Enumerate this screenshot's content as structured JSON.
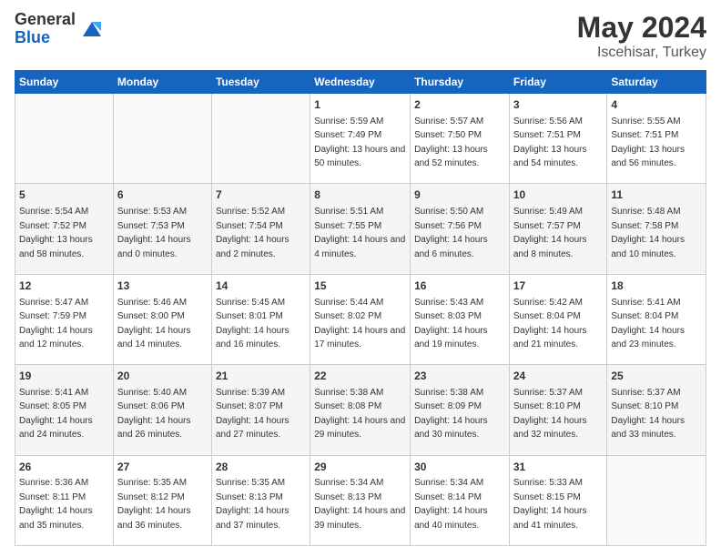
{
  "header": {
    "logo_general": "General",
    "logo_blue": "Blue",
    "month": "May 2024",
    "location": "Iscehisar, Turkey"
  },
  "weekdays": [
    "Sunday",
    "Monday",
    "Tuesday",
    "Wednesday",
    "Thursday",
    "Friday",
    "Saturday"
  ],
  "weeks": [
    [
      {
        "day": "",
        "sunrise": "",
        "sunset": "",
        "daylight": ""
      },
      {
        "day": "",
        "sunrise": "",
        "sunset": "",
        "daylight": ""
      },
      {
        "day": "",
        "sunrise": "",
        "sunset": "",
        "daylight": ""
      },
      {
        "day": "1",
        "sunrise": "Sunrise: 5:59 AM",
        "sunset": "Sunset: 7:49 PM",
        "daylight": "Daylight: 13 hours and 50 minutes."
      },
      {
        "day": "2",
        "sunrise": "Sunrise: 5:57 AM",
        "sunset": "Sunset: 7:50 PM",
        "daylight": "Daylight: 13 hours and 52 minutes."
      },
      {
        "day": "3",
        "sunrise": "Sunrise: 5:56 AM",
        "sunset": "Sunset: 7:51 PM",
        "daylight": "Daylight: 13 hours and 54 minutes."
      },
      {
        "day": "4",
        "sunrise": "Sunrise: 5:55 AM",
        "sunset": "Sunset: 7:51 PM",
        "daylight": "Daylight: 13 hours and 56 minutes."
      }
    ],
    [
      {
        "day": "5",
        "sunrise": "Sunrise: 5:54 AM",
        "sunset": "Sunset: 7:52 PM",
        "daylight": "Daylight: 13 hours and 58 minutes."
      },
      {
        "day": "6",
        "sunrise": "Sunrise: 5:53 AM",
        "sunset": "Sunset: 7:53 PM",
        "daylight": "Daylight: 14 hours and 0 minutes."
      },
      {
        "day": "7",
        "sunrise": "Sunrise: 5:52 AM",
        "sunset": "Sunset: 7:54 PM",
        "daylight": "Daylight: 14 hours and 2 minutes."
      },
      {
        "day": "8",
        "sunrise": "Sunrise: 5:51 AM",
        "sunset": "Sunset: 7:55 PM",
        "daylight": "Daylight: 14 hours and 4 minutes."
      },
      {
        "day": "9",
        "sunrise": "Sunrise: 5:50 AM",
        "sunset": "Sunset: 7:56 PM",
        "daylight": "Daylight: 14 hours and 6 minutes."
      },
      {
        "day": "10",
        "sunrise": "Sunrise: 5:49 AM",
        "sunset": "Sunset: 7:57 PM",
        "daylight": "Daylight: 14 hours and 8 minutes."
      },
      {
        "day": "11",
        "sunrise": "Sunrise: 5:48 AM",
        "sunset": "Sunset: 7:58 PM",
        "daylight": "Daylight: 14 hours and 10 minutes."
      }
    ],
    [
      {
        "day": "12",
        "sunrise": "Sunrise: 5:47 AM",
        "sunset": "Sunset: 7:59 PM",
        "daylight": "Daylight: 14 hours and 12 minutes."
      },
      {
        "day": "13",
        "sunrise": "Sunrise: 5:46 AM",
        "sunset": "Sunset: 8:00 PM",
        "daylight": "Daylight: 14 hours and 14 minutes."
      },
      {
        "day": "14",
        "sunrise": "Sunrise: 5:45 AM",
        "sunset": "Sunset: 8:01 PM",
        "daylight": "Daylight: 14 hours and 16 minutes."
      },
      {
        "day": "15",
        "sunrise": "Sunrise: 5:44 AM",
        "sunset": "Sunset: 8:02 PM",
        "daylight": "Daylight: 14 hours and 17 minutes."
      },
      {
        "day": "16",
        "sunrise": "Sunrise: 5:43 AM",
        "sunset": "Sunset: 8:03 PM",
        "daylight": "Daylight: 14 hours and 19 minutes."
      },
      {
        "day": "17",
        "sunrise": "Sunrise: 5:42 AM",
        "sunset": "Sunset: 8:04 PM",
        "daylight": "Daylight: 14 hours and 21 minutes."
      },
      {
        "day": "18",
        "sunrise": "Sunrise: 5:41 AM",
        "sunset": "Sunset: 8:04 PM",
        "daylight": "Daylight: 14 hours and 23 minutes."
      }
    ],
    [
      {
        "day": "19",
        "sunrise": "Sunrise: 5:41 AM",
        "sunset": "Sunset: 8:05 PM",
        "daylight": "Daylight: 14 hours and 24 minutes."
      },
      {
        "day": "20",
        "sunrise": "Sunrise: 5:40 AM",
        "sunset": "Sunset: 8:06 PM",
        "daylight": "Daylight: 14 hours and 26 minutes."
      },
      {
        "day": "21",
        "sunrise": "Sunrise: 5:39 AM",
        "sunset": "Sunset: 8:07 PM",
        "daylight": "Daylight: 14 hours and 27 minutes."
      },
      {
        "day": "22",
        "sunrise": "Sunrise: 5:38 AM",
        "sunset": "Sunset: 8:08 PM",
        "daylight": "Daylight: 14 hours and 29 minutes."
      },
      {
        "day": "23",
        "sunrise": "Sunrise: 5:38 AM",
        "sunset": "Sunset: 8:09 PM",
        "daylight": "Daylight: 14 hours and 30 minutes."
      },
      {
        "day": "24",
        "sunrise": "Sunrise: 5:37 AM",
        "sunset": "Sunset: 8:10 PM",
        "daylight": "Daylight: 14 hours and 32 minutes."
      },
      {
        "day": "25",
        "sunrise": "Sunrise: 5:37 AM",
        "sunset": "Sunset: 8:10 PM",
        "daylight": "Daylight: 14 hours and 33 minutes."
      }
    ],
    [
      {
        "day": "26",
        "sunrise": "Sunrise: 5:36 AM",
        "sunset": "Sunset: 8:11 PM",
        "daylight": "Daylight: 14 hours and 35 minutes."
      },
      {
        "day": "27",
        "sunrise": "Sunrise: 5:35 AM",
        "sunset": "Sunset: 8:12 PM",
        "daylight": "Daylight: 14 hours and 36 minutes."
      },
      {
        "day": "28",
        "sunrise": "Sunrise: 5:35 AM",
        "sunset": "Sunset: 8:13 PM",
        "daylight": "Daylight: 14 hours and 37 minutes."
      },
      {
        "day": "29",
        "sunrise": "Sunrise: 5:34 AM",
        "sunset": "Sunset: 8:13 PM",
        "daylight": "Daylight: 14 hours and 39 minutes."
      },
      {
        "day": "30",
        "sunrise": "Sunrise: 5:34 AM",
        "sunset": "Sunset: 8:14 PM",
        "daylight": "Daylight: 14 hours and 40 minutes."
      },
      {
        "day": "31",
        "sunrise": "Sunrise: 5:33 AM",
        "sunset": "Sunset: 8:15 PM",
        "daylight": "Daylight: 14 hours and 41 minutes."
      },
      {
        "day": "",
        "sunrise": "",
        "sunset": "",
        "daylight": ""
      }
    ]
  ]
}
